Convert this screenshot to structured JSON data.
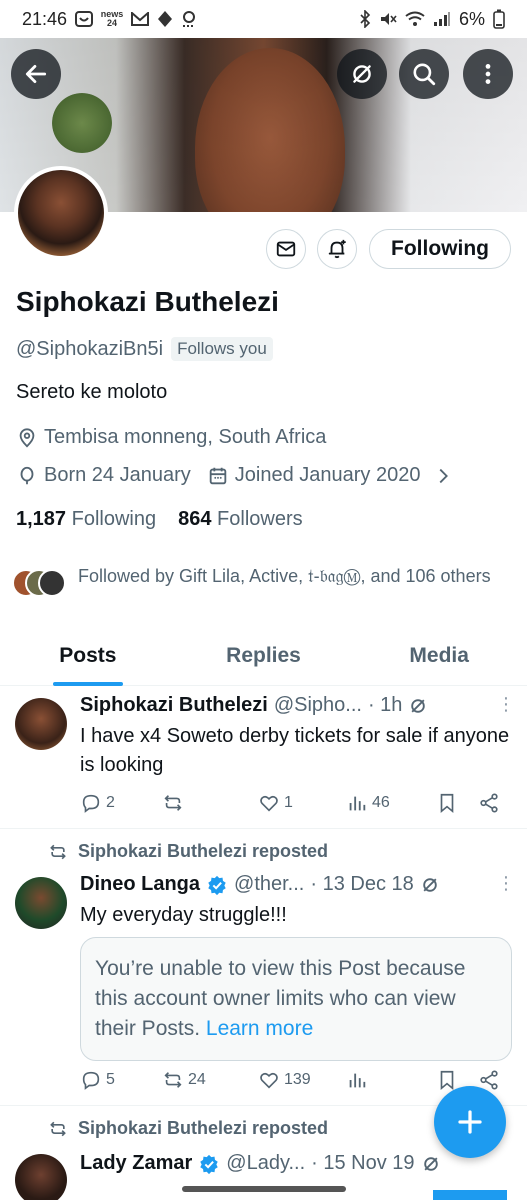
{
  "status_bar": {
    "time": "21:46",
    "news_label": "news 24",
    "battery": "6%"
  },
  "profile": {
    "display_name": "Siphokazi Buthelezi",
    "handle": "@SiphokaziBn5i",
    "follows_you": "Follows you",
    "bio": "Sereto ke moloto",
    "location": "Tembisa monneng, South Africa",
    "born": "Born 24 January",
    "joined": "Joined January 2020",
    "following_count": "1,187",
    "following_label": "Following",
    "followers_count": "864",
    "followers_label": "Followers",
    "followed_by": "Followed by Gift Lila, Active, 𝔱-𝔟𝔞𝔤Ⓜ, and 106 others",
    "following_button": "Following"
  },
  "tabs": [
    {
      "label": "Posts",
      "active": true
    },
    {
      "label": "Replies",
      "active": false
    },
    {
      "label": "Media",
      "active": false
    }
  ],
  "posts": [
    {
      "name": "Siphokazi Buthelezi",
      "handle": "@Sipho...",
      "time": "· 1h",
      "text": "I have x4 Soweto derby tickets for sale if anyone is looking",
      "replies": "2",
      "reposts": "",
      "likes": "1",
      "views": "46"
    },
    {
      "repost_label": "Siphokazi Buthelezi reposted",
      "name": "Dineo Langa",
      "handle": "@ther...",
      "time": "· 13 Dec 18",
      "text": "My everyday struggle!!!",
      "limited_text": "You’re unable to view this Post because this account owner limits who can view their Posts.",
      "learn_more": "Learn more",
      "replies": "5",
      "reposts": "24",
      "likes": "139",
      "views": ""
    },
    {
      "repost_label": "Siphokazi Buthelezi reposted",
      "name": "Lady Zamar",
      "handle": "@Lady...",
      "time": "· 15 Nov 19"
    }
  ],
  "colors": {
    "accent": "#1d9bf0",
    "text_primary": "#0f1419",
    "text_secondary": "#536471",
    "border": "#cfd9de"
  }
}
